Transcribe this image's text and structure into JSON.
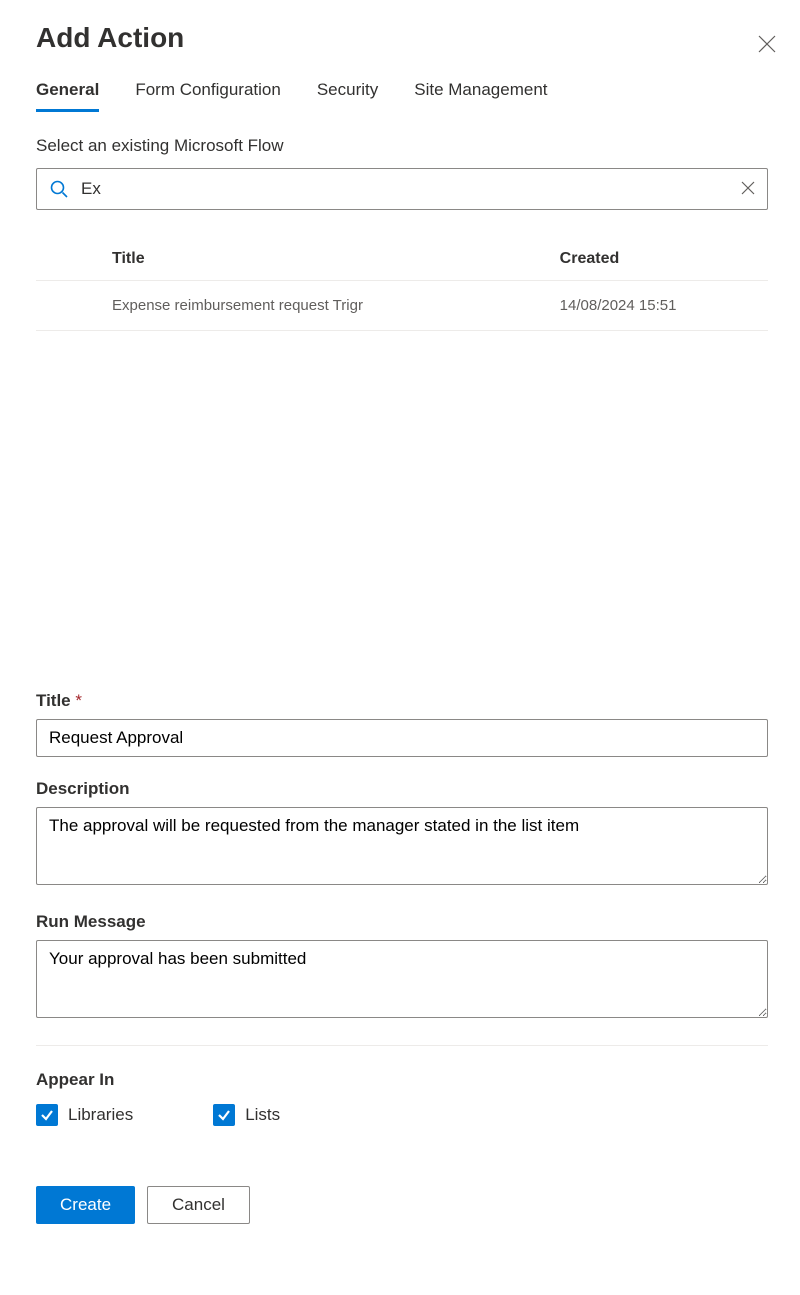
{
  "header": {
    "title": "Add Action"
  },
  "tabs": [
    {
      "label": "General",
      "active": true
    },
    {
      "label": "Form Configuration",
      "active": false
    },
    {
      "label": "Security",
      "active": false
    },
    {
      "label": "Site Management",
      "active": false
    }
  ],
  "flow_picker": {
    "label": "Select an existing Microsoft Flow",
    "search_value": "Ex",
    "columns": {
      "title": "Title",
      "created": "Created"
    },
    "results": [
      {
        "title": "Expense reimbursement request Trigr",
        "created": "14/08/2024 15:51"
      }
    ]
  },
  "fields": {
    "title": {
      "label": "Title",
      "required_marker": "*",
      "value": "Request Approval"
    },
    "description": {
      "label": "Description",
      "value": "The approval will be requested from the manager stated in the list item"
    },
    "run_message": {
      "label": "Run Message",
      "value": "Your approval has been submitted"
    },
    "appear_in": {
      "label": "Appear In",
      "options": [
        {
          "label": "Libraries",
          "checked": true
        },
        {
          "label": "Lists",
          "checked": true
        }
      ]
    }
  },
  "footer": {
    "primary": "Create",
    "secondary": "Cancel"
  }
}
